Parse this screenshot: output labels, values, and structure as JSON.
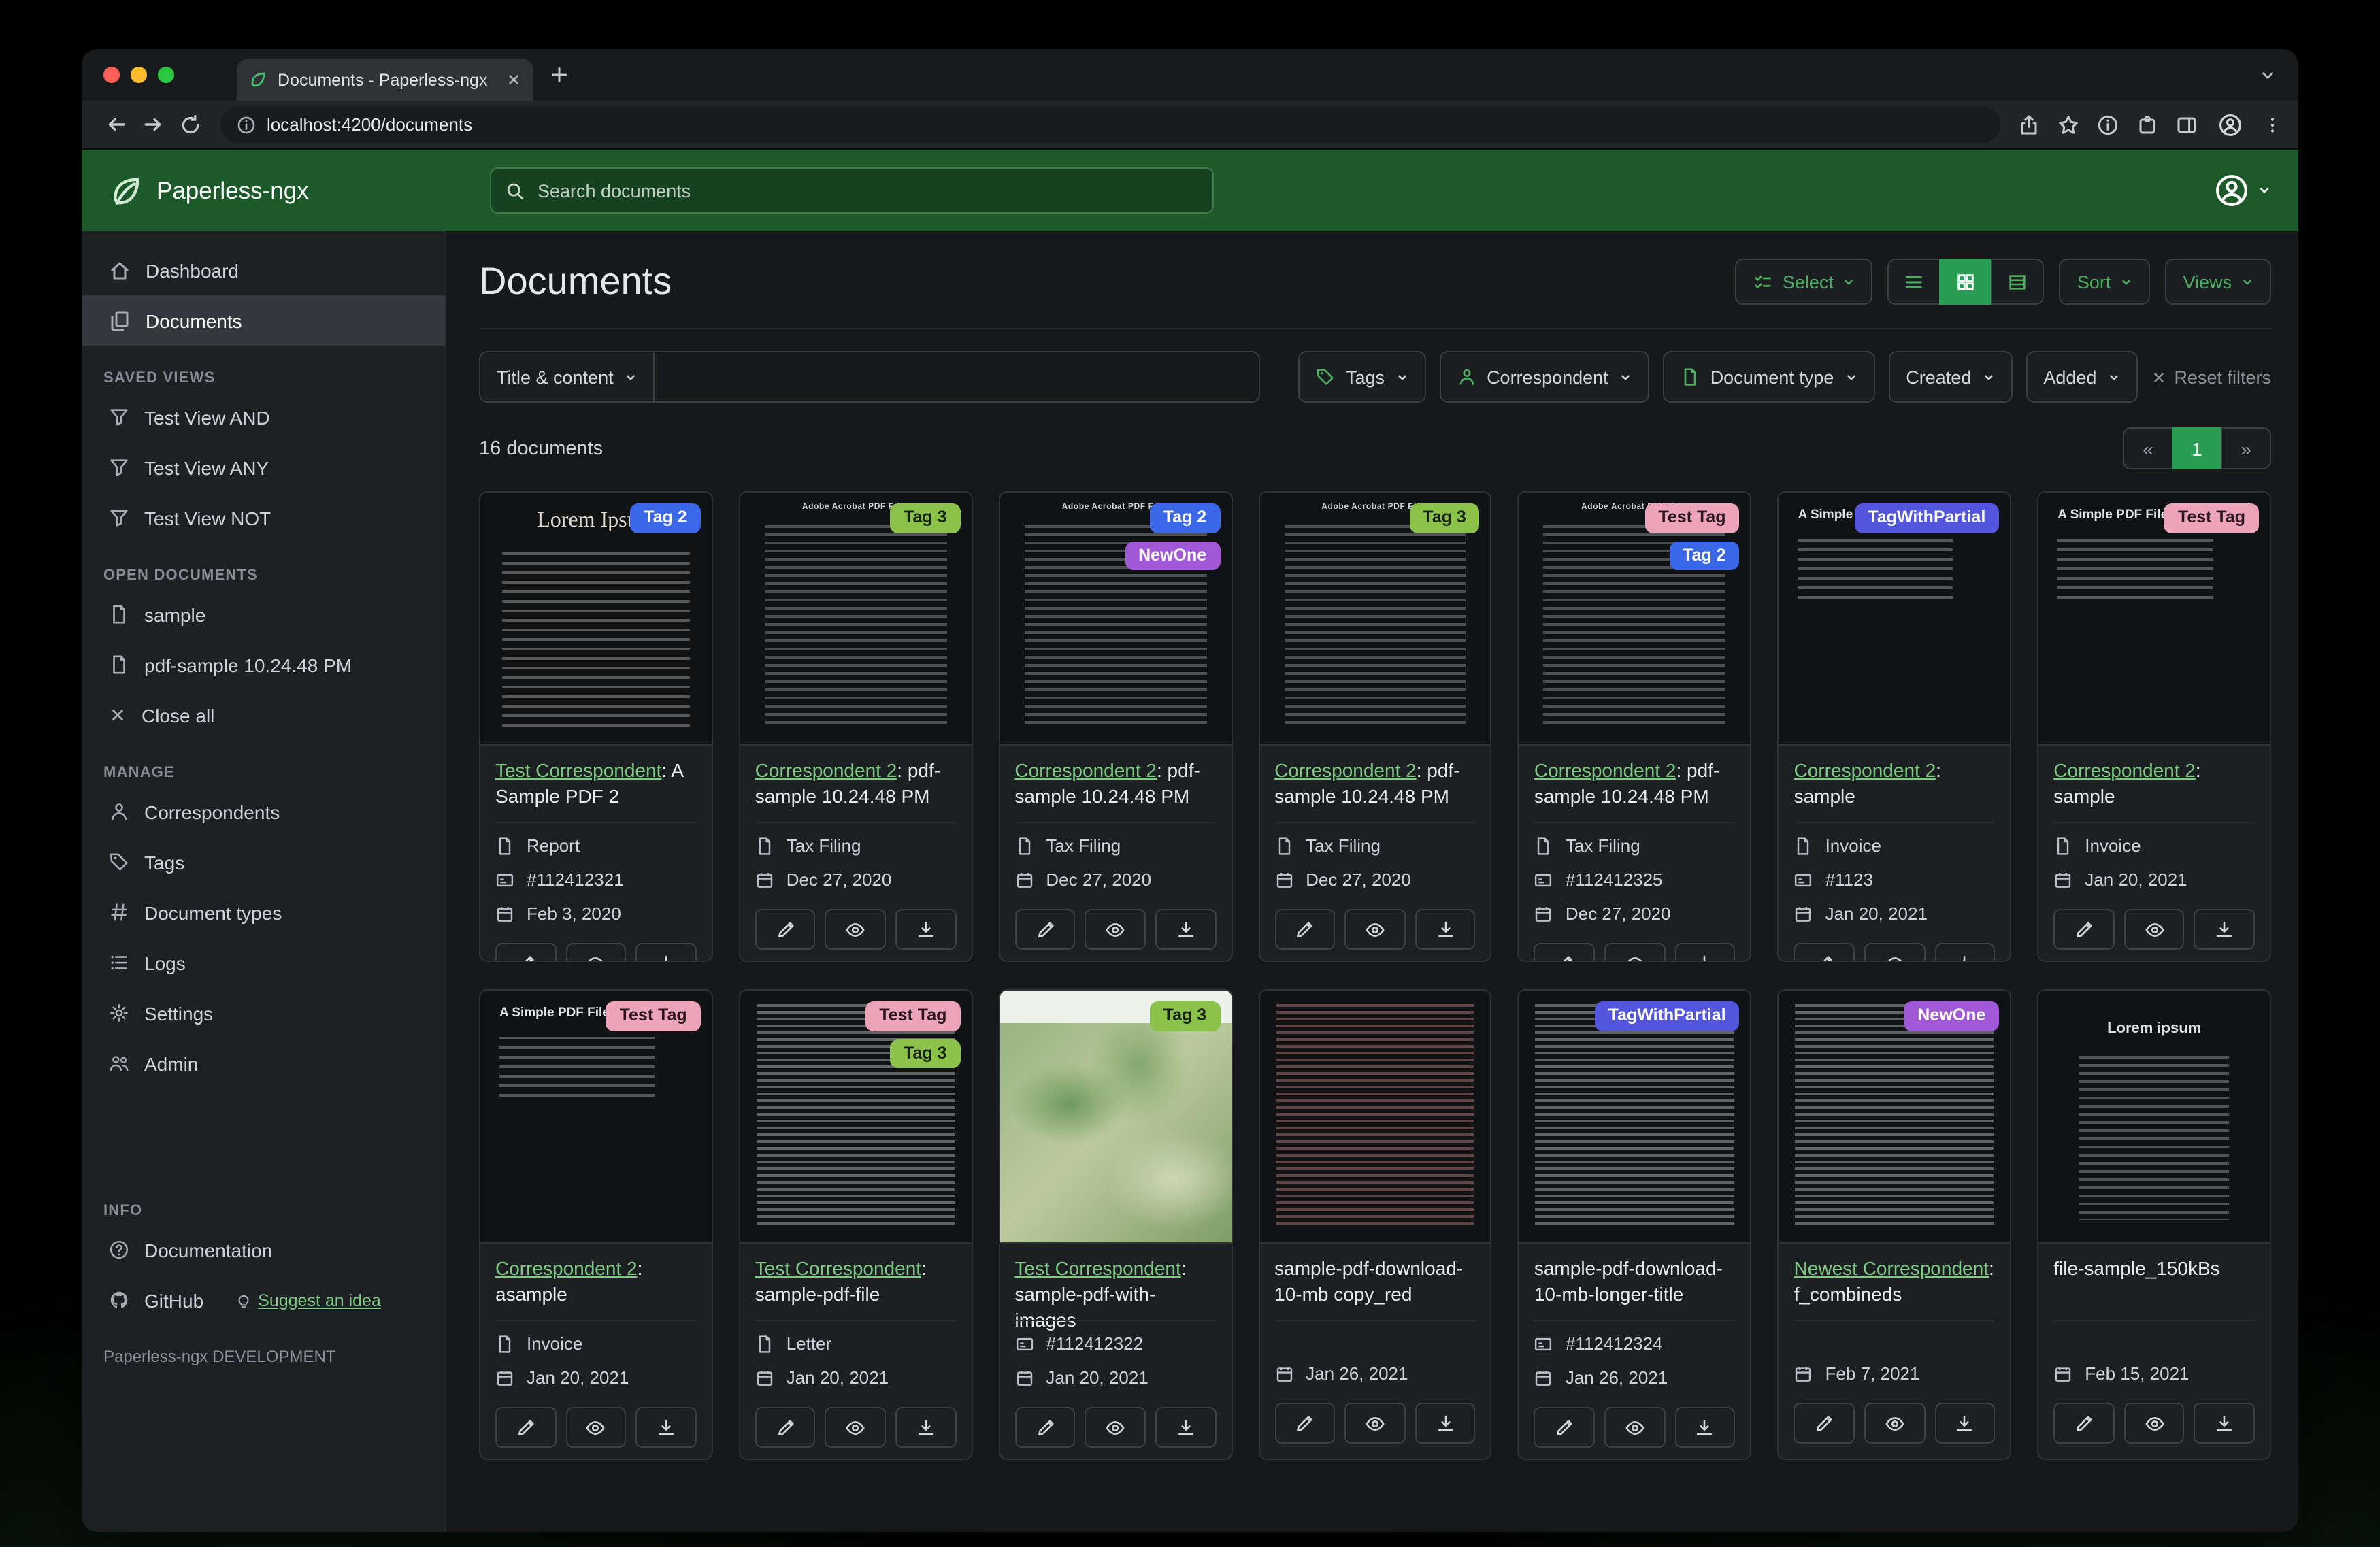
{
  "browser": {
    "tab_title": "Documents - Paperless-ngx",
    "url": "localhost:4200/documents"
  },
  "app_header": {
    "app_name": "Paperless-ngx",
    "search_placeholder": "Search documents"
  },
  "sidebar": {
    "dashboard": "Dashboard",
    "documents": "Documents",
    "saved_views_heading": "SAVED VIEWS",
    "saved_views": [
      "Test View AND",
      "Test View ANY",
      "Test View NOT"
    ],
    "open_documents_heading": "OPEN DOCUMENTS",
    "open_documents": [
      "sample",
      "pdf-sample 10.24.48 PM"
    ],
    "close_all": "Close all",
    "manage_heading": "MANAGE",
    "manage": [
      "Correspondents",
      "Tags",
      "Document types",
      "Logs",
      "Settings",
      "Admin"
    ],
    "info_heading": "INFO",
    "documentation": "Documentation",
    "github": "GitHub",
    "suggest_idea": "Suggest an idea",
    "footer": "Paperless-ngx DEVELOPMENT"
  },
  "toolbar": {
    "title": "Documents",
    "select": "Select",
    "sort": "Sort",
    "views": "Views"
  },
  "filters": {
    "title_content": "Title & content",
    "search_value": "",
    "tags": "Tags",
    "correspondent": "Correspondent",
    "document_type": "Document type",
    "created": "Created",
    "added": "Added",
    "reset": "Reset filters"
  },
  "results": {
    "count": "16 documents",
    "prev": "«",
    "page": "1",
    "next": "»"
  },
  "colors": {
    "header_green": "#1d5a2a",
    "accent_green": "#4cae5f",
    "active_green": "#2a9d54",
    "link_green": "#7ec983",
    "tag_blue": "#3b68e8",
    "tag_green": "#8bc34a",
    "tag_pink": "#eda3b9",
    "tag_purple": "#a158d6",
    "tag_indigo": "#5156dd"
  },
  "cards": [
    {
      "tags": [
        {
          "label": "Tag 2",
          "color": "#3b68e8",
          "text_color": "#ffffff"
        }
      ],
      "thumb": {
        "style": "lorem",
        "text": "Lorem Ipsum"
      },
      "correspondent": "Test Correspondent",
      "title": ": A Sample PDF 2",
      "type": "Report",
      "asn": "#112412321",
      "date": "Feb 3, 2020"
    },
    {
      "tags": [
        {
          "label": "Tag 3",
          "color": "#8bc34a",
          "text_color": "#17220d"
        }
      ],
      "thumb": {
        "style": "adobe",
        "text": "Adobe Acrobat PDF Files"
      },
      "correspondent": "Correspondent 2",
      "title": ": pdf-sample 10.24.48 PM",
      "type": "Tax Filing",
      "asn": null,
      "date": "Dec 27, 2020"
    },
    {
      "tags": [
        {
          "label": "Tag 2",
          "color": "#3b68e8",
          "text_color": "#ffffff"
        },
        {
          "label": "NewOne",
          "color": "#a158d6",
          "text_color": "#ffffff"
        }
      ],
      "thumb": {
        "style": "adobe",
        "text": "Adobe Acrobat PDF Files"
      },
      "correspondent": "Correspondent 2",
      "title": ": pdf-sample 10.24.48 PM",
      "type": "Tax Filing",
      "asn": null,
      "date": "Dec 27, 2020"
    },
    {
      "tags": [
        {
          "label": "Tag 3",
          "color": "#8bc34a",
          "text_color": "#17220d"
        }
      ],
      "thumb": {
        "style": "adobe",
        "text": "Adobe Acrobat PDF Files"
      },
      "correspondent": "Correspondent 2",
      "title": ": pdf-sample 10.24.48 PM",
      "type": "Tax Filing",
      "asn": null,
      "date": "Dec 27, 2020"
    },
    {
      "tags": [
        {
          "label": "Test Tag",
          "color": "#eda3b9",
          "text_color": "#2a1620"
        },
        {
          "label": "Tag 2",
          "color": "#3b68e8",
          "text_color": "#ffffff"
        }
      ],
      "thumb": {
        "style": "adobe",
        "text": "Adobe Acrobat PDF Files"
      },
      "correspondent": "Correspondent 2",
      "title": ": pdf-sample 10.24.48 PM",
      "type": "Tax Filing",
      "asn": "#112412325",
      "date": "Dec 27, 2020"
    },
    {
      "tags": [
        {
          "label": "TagWithPartial",
          "color": "#5156dd",
          "text_color": "#ffffff"
        }
      ],
      "thumb": {
        "style": "simple",
        "text": "A Simple PDF File"
      },
      "correspondent": "Correspondent 2",
      "title": ": sample",
      "type": "Invoice",
      "asn": "#1123",
      "date": "Jan 20, 2021"
    },
    {
      "tags": [
        {
          "label": "Test Tag",
          "color": "#eda3b9",
          "text_color": "#2a1620"
        }
      ],
      "thumb": {
        "style": "simple",
        "text": "A Simple PDF File"
      },
      "correspondent": "Correspondent 2",
      "title": ": sample",
      "type": "Invoice",
      "asn": null,
      "date": "Jan 20, 2021"
    },
    {
      "tags": [
        {
          "label": "Test Tag",
          "color": "#eda3b9",
          "text_color": "#2a1620"
        }
      ],
      "thumb": {
        "style": "simple",
        "text": "A Simple PDF File"
      },
      "correspondent": "Correspondent 2",
      "title": ": asample",
      "type": "Invoice",
      "asn": null,
      "date": "Jan 20, 2021"
    },
    {
      "tags": [
        {
          "label": "Test Tag",
          "color": "#eda3b9",
          "text_color": "#2a1620"
        },
        {
          "label": "Tag 3",
          "color": "#8bc34a",
          "text_color": "#17220d"
        }
      ],
      "thumb": {
        "style": "dense",
        "text": ""
      },
      "correspondent": "Test Correspondent",
      "title": ": sample-pdf-file",
      "type": "Letter",
      "asn": null,
      "date": "Jan 20, 2021"
    },
    {
      "tags": [
        {
          "label": "Tag 3",
          "color": "#8bc34a",
          "text_color": "#17220d"
        }
      ],
      "thumb": {
        "style": "map",
        "text": ""
      },
      "correspondent": "Test Correspondent",
      "title": ": sample-pdf-with-images",
      "type": null,
      "asn": "#112412322",
      "date": "Jan 20, 2021"
    },
    {
      "tags": [],
      "thumb": {
        "style": "dense_red",
        "text": ""
      },
      "correspondent": null,
      "title": "sample-pdf-download-10-mb copy_red",
      "type": null,
      "asn": null,
      "date": "Jan 26, 2021"
    },
    {
      "tags": [
        {
          "label": "TagWithPartial",
          "color": "#5156dd",
          "text_color": "#ffffff"
        }
      ],
      "thumb": {
        "style": "dense",
        "text": ""
      },
      "correspondent": null,
      "title": "sample-pdf-download-10-mb-longer-title",
      "type": null,
      "asn": "#112412324",
      "date": "Jan 26, 2021"
    },
    {
      "tags": [
        {
          "label": "NewOne",
          "color": "#a158d6",
          "text_color": "#ffffff"
        }
      ],
      "thumb": {
        "style": "dense",
        "text": ""
      },
      "correspondent": "Newest Correspondent",
      "title": ": f_combineds",
      "type": null,
      "asn": null,
      "date": "Feb 7, 2021"
    },
    {
      "tags": [],
      "thumb": {
        "style": "lorem2",
        "text": "Lorem ipsum"
      },
      "correspondent": null,
      "title": "file-sample_150kBs",
      "type": null,
      "asn": null,
      "date": "Feb 15, 2021"
    }
  ]
}
